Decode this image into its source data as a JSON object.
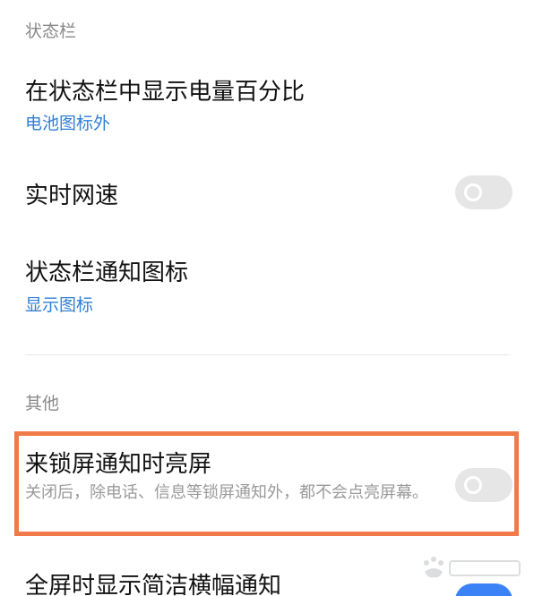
{
  "sections": {
    "status_bar": {
      "header": "状态栏",
      "battery_percentage": {
        "title": "在状态栏中显示电量百分比",
        "value": "电池图标外"
      },
      "realtime_speed": {
        "title": "实时网速",
        "enabled": false
      },
      "notification_icons": {
        "title": "状态栏通知图标",
        "value": "显示图标"
      }
    },
    "others": {
      "header": "其他",
      "wake_on_lockscreen_notification": {
        "title": "来锁屏通知时亮屏",
        "description": "关闭后，除电话、信息等锁屏通知外，都不会点亮屏幕。",
        "enabled": false
      },
      "fullscreen_banner": {
        "title": "全屏时显示简洁横幅通知"
      }
    }
  },
  "highlight_color": "#f07a4a",
  "accent_color": "#2f7fd6"
}
